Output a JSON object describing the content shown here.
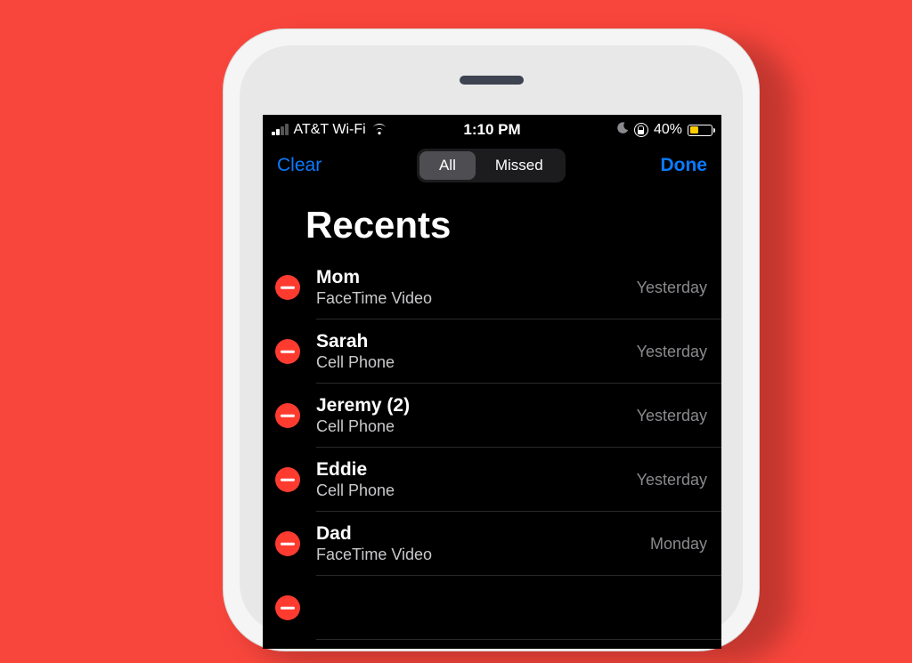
{
  "status": {
    "carrier": "AT&T Wi-Fi",
    "signal_active_bars": 2,
    "signal_total_bars": 4,
    "time": "1:10 PM",
    "dnd": true,
    "orientation_locked": true,
    "battery_pct_label": "40%",
    "battery_pct": 40,
    "low_power_color": "#ffcc00"
  },
  "nav": {
    "left_label": "Clear",
    "right_label": "Done",
    "segments": [
      {
        "label": "All",
        "selected": true
      },
      {
        "label": "Missed",
        "selected": false
      }
    ]
  },
  "title": "Recents",
  "calls": [
    {
      "name": "Mom",
      "sub": "FaceTime Video",
      "time": "Yesterday"
    },
    {
      "name": "Sarah",
      "sub": "Cell Phone",
      "time": "Yesterday"
    },
    {
      "name": "Jeremy (2)",
      "sub": "Cell Phone",
      "time": "Yesterday"
    },
    {
      "name": "Eddie",
      "sub": "Cell Phone",
      "time": "Yesterday"
    },
    {
      "name": "Dad",
      "sub": "FaceTime Video",
      "time": "Monday"
    }
  ],
  "colors": {
    "background": "#f9463c",
    "accent": "#0a7aff",
    "delete": "#ff3b30"
  }
}
